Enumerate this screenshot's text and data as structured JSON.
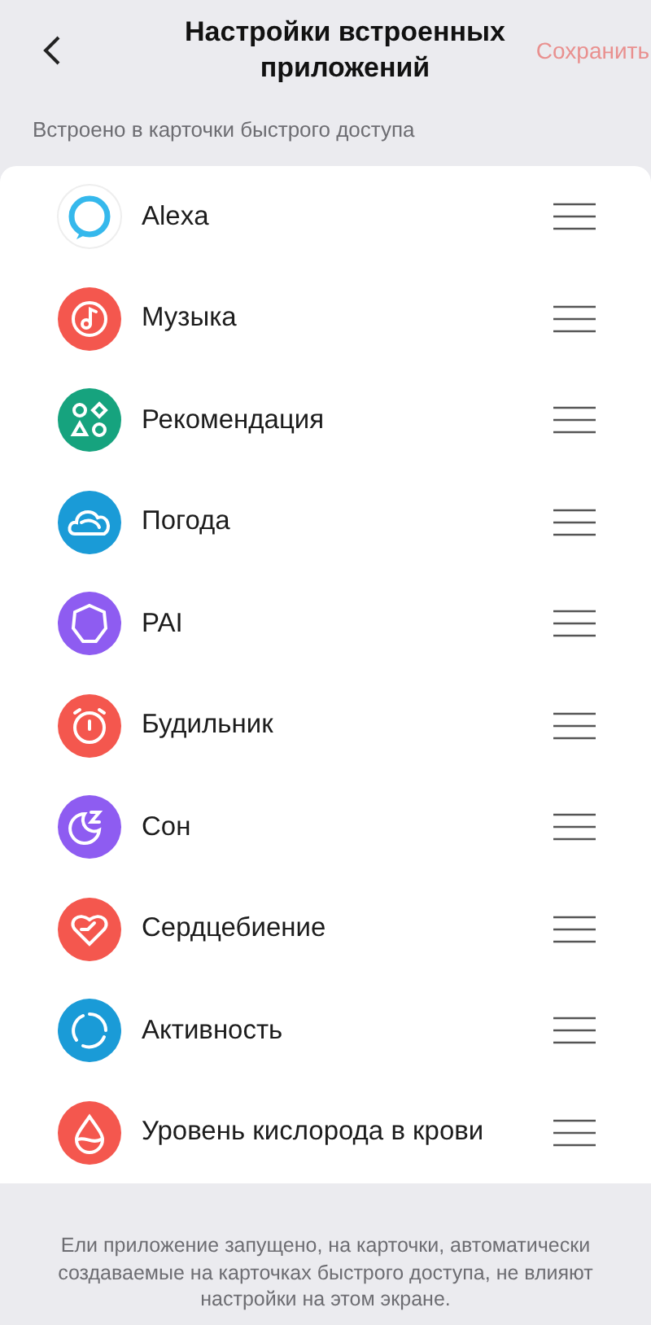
{
  "header": {
    "title": "Настройки встроенных приложений",
    "save": {
      "label": "Сохранить",
      "disabled": true
    }
  },
  "section_label": "Встроено в карточки быстрого доступа",
  "apps": [
    {
      "name": "Alexa",
      "kind": "alexa",
      "color": "#35b8ec"
    },
    {
      "name": "Музыка",
      "kind": "music",
      "color": "#f4574e"
    },
    {
      "name": "Рекомендация",
      "kind": "shapes",
      "color": "#16a37e"
    },
    {
      "name": "Погода",
      "kind": "cloud",
      "color": "#1a9bd7"
    },
    {
      "name": "PAI",
      "kind": "pai",
      "color": "#8e5cf1"
    },
    {
      "name": "Будильник",
      "kind": "alarm",
      "color": "#f4574e"
    },
    {
      "name": "Сон",
      "kind": "sleep",
      "color": "#8e5cf1"
    },
    {
      "name": "Сердцебиение",
      "kind": "heart",
      "color": "#f4574e"
    },
    {
      "name": "Активность",
      "kind": "ring",
      "color": "#1a9bd7"
    },
    {
      "name": "Уровень кислорода в крови",
      "kind": "drop",
      "color": "#f4574e"
    }
  ],
  "footer_note": "Ели приложение запущено, на карточки, автоматически создаваемые на карточках быстрого доступа, не влияют настройки на этом экране."
}
